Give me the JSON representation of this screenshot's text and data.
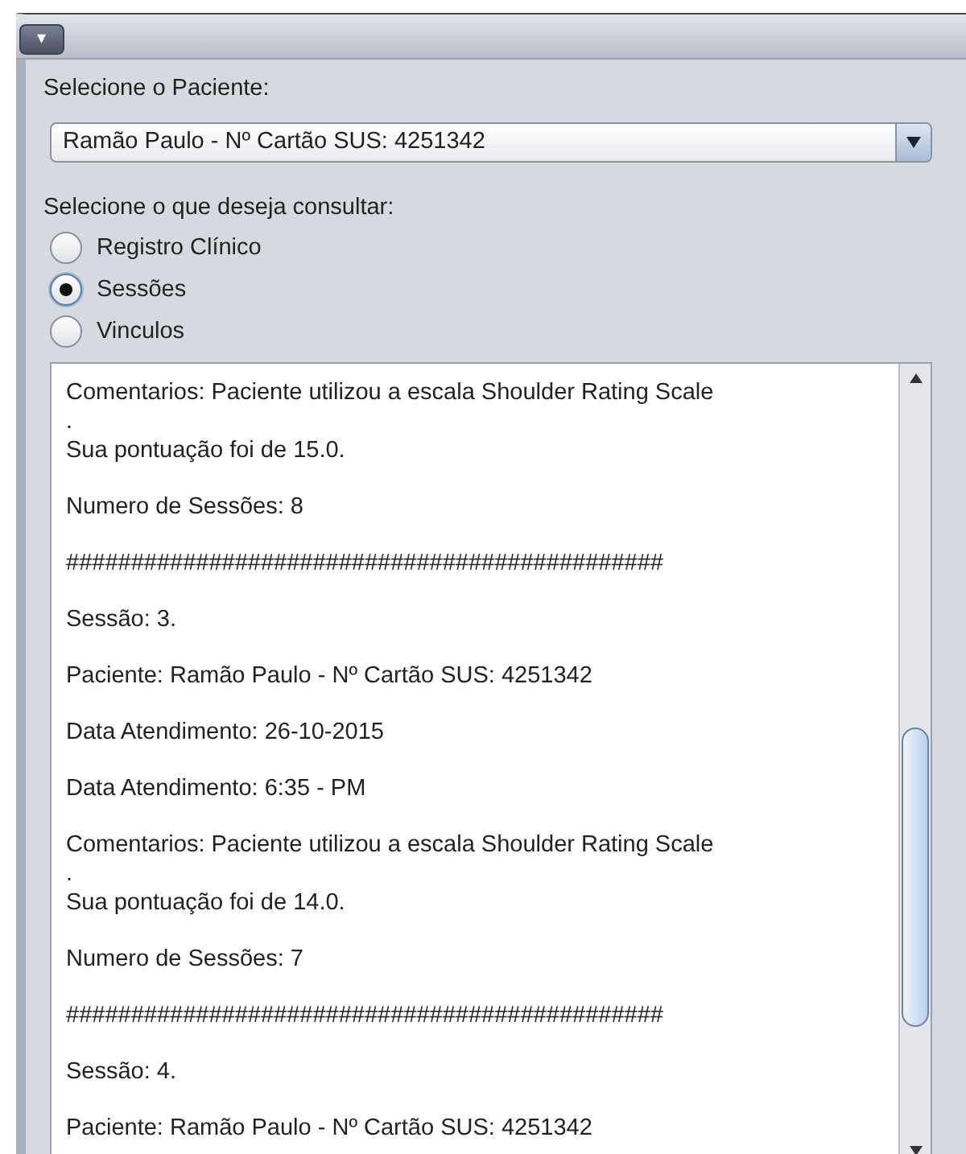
{
  "title_bar": {
    "menu_button": "▾"
  },
  "patient_label": "Selecione o Paciente:",
  "patient_combo": {
    "value": "Ramão Paulo - Nº Cartão SUS: 4251342"
  },
  "query_label": "Selecione o que deseja consultar:",
  "options": [
    {
      "label": "Registro Clínico",
      "selected": false
    },
    {
      "label": "Sessões",
      "selected": true
    },
    {
      "label": "Vinculos",
      "selected": false
    }
  ],
  "text_area": {
    "paragraphs": [
      {
        "lines": [
          "Comentarios: Paciente utilizou a escala Shoulder Rating Scale",
          ".",
          "Sua pontuação foi de 15.0."
        ]
      },
      {
        "lines": [
          "Numero de Sessões: 8"
        ]
      },
      {
        "lines": [
          "##############################################"
        ]
      },
      {
        "lines": [
          "Sessão: 3."
        ]
      },
      {
        "lines": [
          "Paciente: Ramão Paulo - Nº Cartão SUS: 4251342"
        ]
      },
      {
        "lines": [
          "Data Atendimento: 26-10-2015"
        ]
      },
      {
        "lines": [
          "Data Atendimento: 6:35 - PM"
        ]
      },
      {
        "lines": [
          "Comentarios: Paciente utilizou a escala Shoulder Rating Scale",
          ".",
          "Sua pontuação foi de 14.0."
        ]
      },
      {
        "lines": [
          "Numero de Sessões: 7"
        ]
      },
      {
        "lines": [
          "##############################################"
        ]
      },
      {
        "lines": [
          "Sessão: 4."
        ]
      },
      {
        "lines": [
          "Paciente: Ramão Paulo - Nº Cartão SUS: 4251342"
        ]
      }
    ]
  }
}
